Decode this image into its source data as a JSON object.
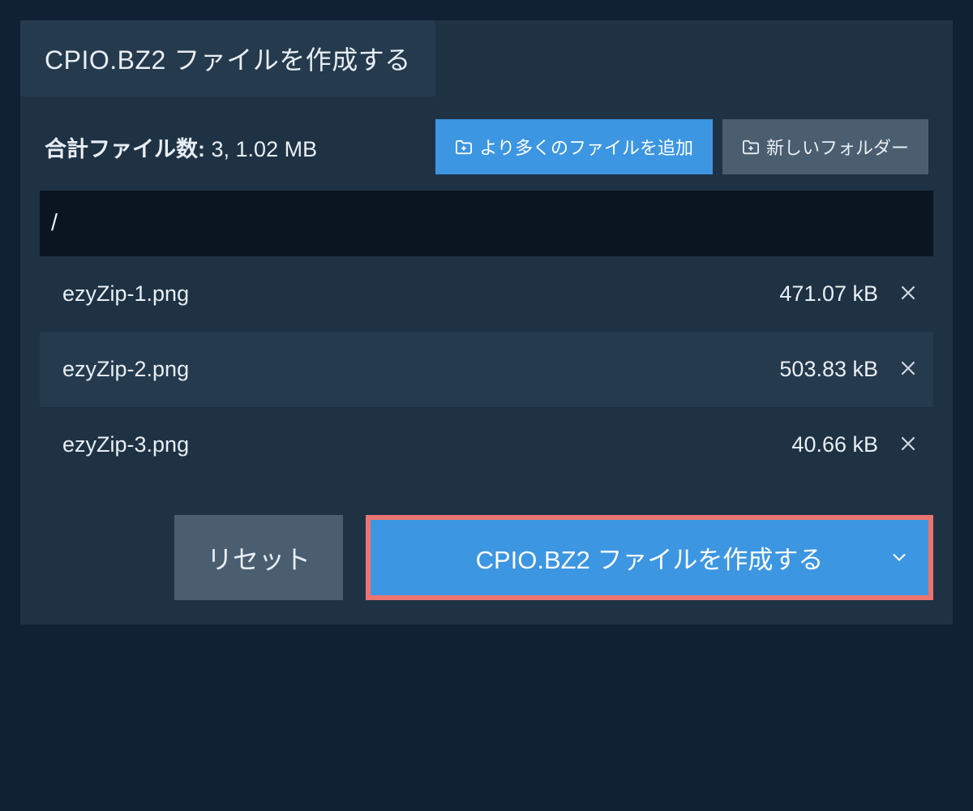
{
  "header": {
    "title": "CPIO.BZ2 ファイルを作成する"
  },
  "summary": {
    "label": "合計ファイル数:",
    "value": "3, 1.02 MB"
  },
  "toolbar": {
    "add_files_label": "より多くのファイルを追加",
    "new_folder_label": "新しいフォルダー"
  },
  "path": "/",
  "files": [
    {
      "name": "ezyZip-1.png",
      "size": "471.07 kB"
    },
    {
      "name": "ezyZip-2.png",
      "size": "503.83 kB"
    },
    {
      "name": "ezyZip-3.png",
      "size": "40.66 kB"
    }
  ],
  "actions": {
    "reset_label": "リセット",
    "create_label": "CPIO.BZ2 ファイルを作成する"
  }
}
